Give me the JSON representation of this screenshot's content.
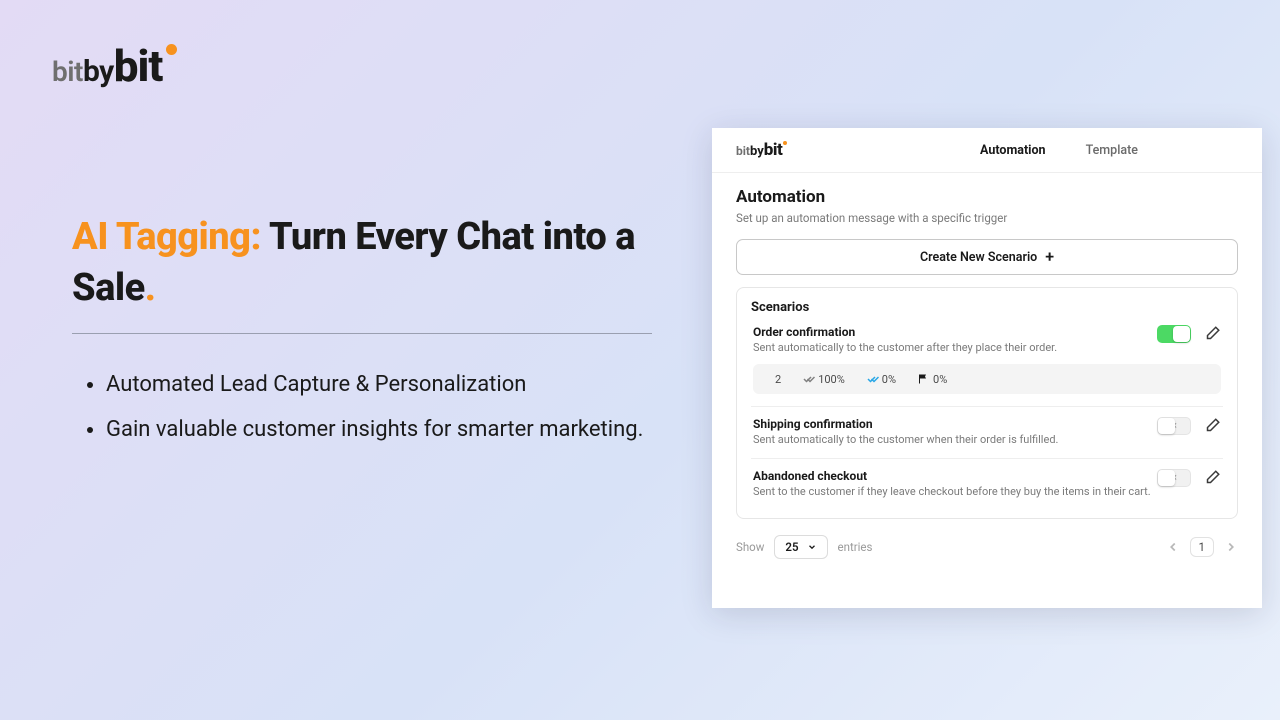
{
  "logo": {
    "part1": "bit",
    "part2": "by",
    "part3": "bit"
  },
  "copy": {
    "headline_accent": "AI Tagging:",
    "headline_rest": " Turn Every Chat into a Sale",
    "headline_dot": ".",
    "bullets": [
      "Automated Lead Capture & Personalization",
      "Gain valuable customer insights for smarter marketing."
    ]
  },
  "app": {
    "logo": {
      "part1": "bit",
      "part2": "by",
      "part3": "bit"
    },
    "tabs": [
      {
        "label": "Automation",
        "active": true
      },
      {
        "label": "Template",
        "active": false
      }
    ],
    "section": {
      "title": "Automation",
      "subtitle": "Set up an automation message with a specific trigger"
    },
    "create_button": "Create New Scenario",
    "panel_title": "Scenarios",
    "scenarios": [
      {
        "title": "Order confirmation",
        "desc": "Sent automatically to the customer after they place their order.",
        "enabled": true,
        "stats": {
          "count": "2",
          "delivered": "100%",
          "read": "0%",
          "flagged": "0%"
        }
      },
      {
        "title": "Shipping confirmation",
        "desc": "Sent automatically to the customer when their order is fulfilled.",
        "enabled": false
      },
      {
        "title": "Abandoned checkout",
        "desc": "Sent to the customer if they leave checkout before they buy the items in their cart.",
        "enabled": false
      }
    ],
    "pagination": {
      "show_label": "Show",
      "page_size": "25",
      "entries_label": "entries",
      "current_page": "1"
    }
  }
}
